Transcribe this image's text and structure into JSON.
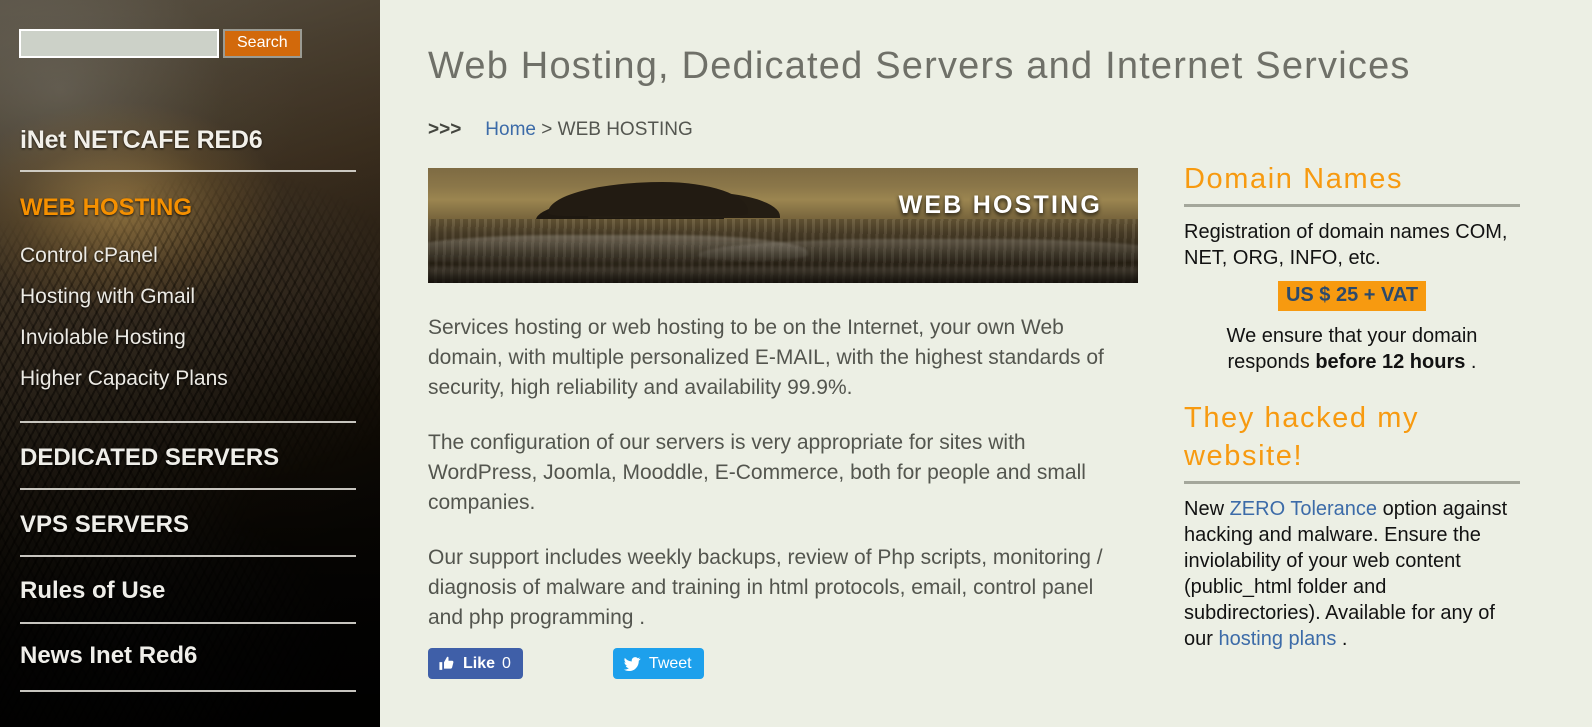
{
  "search": {
    "value": "",
    "placeholder": "",
    "button_label": "Search"
  },
  "sidebar": {
    "brand": "iNet NETCAFE RED6",
    "items": [
      {
        "label": "WEB HOSTING",
        "kind": "current"
      },
      {
        "label": "Control cPanel",
        "kind": "sub"
      },
      {
        "label": "Hosting with Gmail",
        "kind": "sub"
      },
      {
        "label": "Inviolable Hosting",
        "kind": "sub"
      },
      {
        "label": "Higher Capacity Plans",
        "kind": "sub"
      },
      {
        "label": "DEDICATED SERVERS",
        "kind": "major"
      },
      {
        "label": "VPS SERVERS",
        "kind": "major"
      },
      {
        "label": "Rules of Use",
        "kind": "major"
      },
      {
        "label": "News Inet Red6",
        "kind": "major"
      }
    ]
  },
  "header": {
    "title": "Web Hosting, Dedicated Servers and Internet Services"
  },
  "breadcrumb": {
    "arrows": ">>>",
    "home": "Home",
    "separator": ">",
    "current": "WEB HOSTING"
  },
  "hero": {
    "label": "WEB HOSTING"
  },
  "article": {
    "paragraphs": [
      "Services  hosting or web hosting  to be on the Internet, your own Web domain, with multiple personalized E-MAIL, with the highest standards of security, high reliability and availability 99.9%.",
      "The configuration of our servers is very appropriate for sites with WordPress, Joomla, Mooddle, E-Commerce, both for people and small companies.",
      "Our support includes weekly backups, review of Php scripts, monitoring / diagnosis of malware and training in html protocols, email, control panel and php programming ."
    ]
  },
  "social": {
    "facebook_label": "Like",
    "facebook_count": "0",
    "twitter_label": "Tweet"
  },
  "rail": {
    "domain_widget": {
      "title": "Domain Names",
      "intro": "Registration of domain names COM, NET, ORG, INFO, etc.",
      "price": "US $ 25 + VAT",
      "guarantee_prefix": "We ensure that your domain responds ",
      "guarantee_bold": "before 12 hours",
      "guarantee_suffix": " ."
    },
    "hacked_widget": {
      "title": "They hacked my website!",
      "body_1": "New ",
      "link_1": "ZERO Tolerance",
      "body_2": " option against hacking and malware. Ensure the inviolability of your web content (public_html folder and subdirectories). Available for any of our ",
      "link_2": "hosting plans",
      "body_3": " ."
    }
  },
  "colors": {
    "page_background": "#ecefe4",
    "accent_orange": "#f79a10",
    "search_button_orange": "#d2690b",
    "link_blue": "#3c6ba8",
    "title_gray": "#6f7068",
    "body_gray": "#53554e",
    "facebook_blue": "#3f5fa8",
    "twitter_blue": "#1da0ec",
    "rule_gray": "#a4a79b"
  }
}
